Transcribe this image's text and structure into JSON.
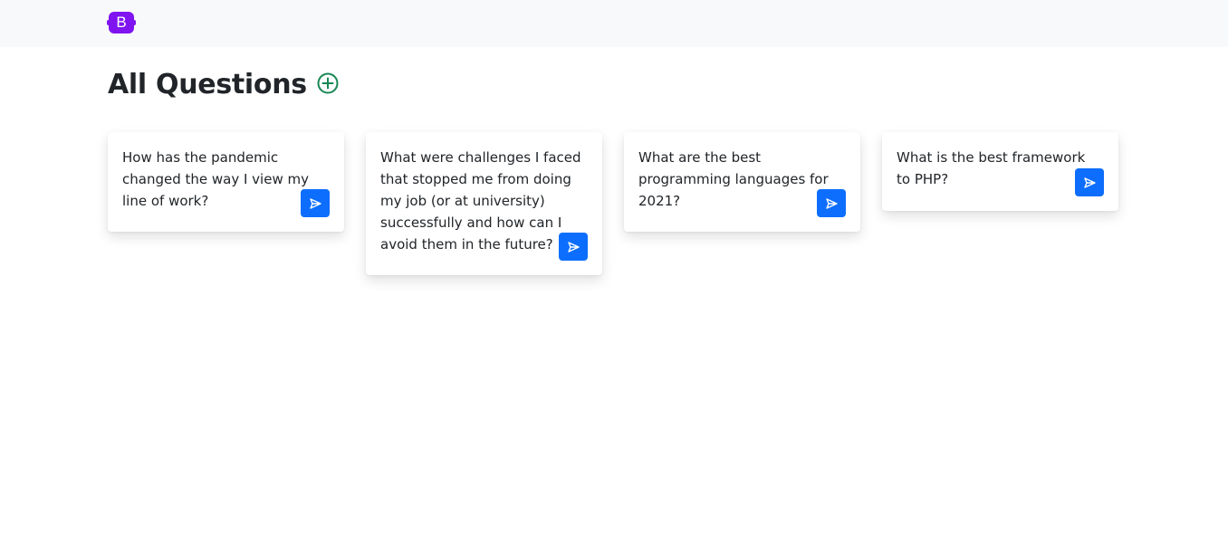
{
  "navbar": {
    "brand_letter": "B",
    "brand_color": "#7f14f0",
    "background": "#f8f9fa"
  },
  "header": {
    "title": "All Questions",
    "add_icon": "plus-circle-icon",
    "add_icon_color": "#198754"
  },
  "questions": [
    {
      "text": "How has the pandemic changed the way I view my line of work?",
      "action_icon": "send-icon"
    },
    {
      "text": "What were challenges I faced that stopped me from doing my job (or at university) successfully and how can I avoid them in the future?",
      "action_icon": "send-icon"
    },
    {
      "text": "What are the best programming languages for 2021?",
      "action_icon": "send-icon"
    },
    {
      "text": "What is the best framework to PHP?",
      "action_icon": "send-icon"
    }
  ],
  "colors": {
    "primary": "#0d6efd",
    "text": "#212529"
  }
}
